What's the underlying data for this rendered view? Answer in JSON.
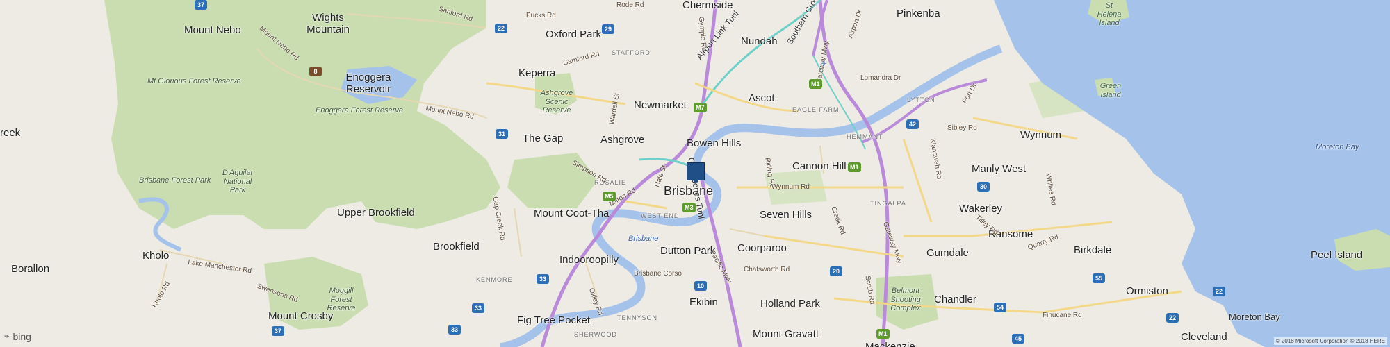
{
  "map": {
    "colors": {
      "land": "#eeebe4",
      "park": "#c9ddb0",
      "water": "#a4c2ea",
      "motorway": "#b98ad9",
      "major": "#f3d88a",
      "tunnel": "#6fd0c9"
    },
    "places": {
      "chermside": "Chermside",
      "pinkenba": "Pinkenba",
      "oxford_park": "Oxford Park",
      "nundah": "Nundah",
      "mount_nebo": "Mount Nebo",
      "wights_mountain": "Wights Mountain",
      "keperra": "Keperra",
      "enoggera_reservoir": "Enoggera Reservoir",
      "newmarket": "Newmarket",
      "ascot": "Ascot",
      "the_gap": "The Gap",
      "ashgrove": "Ashgrove",
      "bowen_hills": "Bowen Hills",
      "wynnum": "Wynnum",
      "cannon_hill": "Cannon Hill",
      "manly_west": "Manly West",
      "brisbane": "Brisbane",
      "mount_coot_tha": "Mount Coot-Tha",
      "seven_hills": "Seven Hills",
      "wakerley": "Wakerley",
      "upper_brookfield": "Upper Brookfield",
      "ransome": "Ransome",
      "brookfield": "Brookfield",
      "dutton_park": "Dutton Park",
      "coorparoo": "Coorparoo",
      "gumdale": "Gumdale",
      "kholo": "Kholo",
      "borallon": "Borallon",
      "indooroopilly": "Indooroopilly",
      "birkdale": "Birkdale",
      "peel_island": "Peel Island",
      "ormiston": "Ormiston",
      "chandler": "Chandler",
      "holland_park": "Holland Park",
      "mount_crosby": "Mount Crosby",
      "ekibin": "Ekibin",
      "fig_tree_pocket": "Fig Tree Pocket",
      "cleveland": "Cleveland",
      "mount_gravatt": "Mount Gravatt",
      "mackenzie": "Mackenzie",
      "creek": "reek"
    },
    "parks": {
      "mt_glorious": "Mt Glorious Forest Reserve",
      "enoggera_forest": "Enoggera Forest Reserve",
      "daguilar": "D'Aguilar National Park",
      "brisbane_forest": "Brisbane Forest Park",
      "ashgrove_scenic": "Ashgrove Scenic Reserve",
      "moggill": "Moggill Forest Reserve",
      "belmont": "Belmont Shooting Complex"
    },
    "water": {
      "moreton_bay_top": "Moreton Bay",
      "moreton_bay_bottom": "Moreton Bay",
      "brisbane_river": "Brisbane"
    },
    "islands": {
      "st_helena": "St Helena Island",
      "green": "Green Island"
    },
    "suburbs": {
      "stafford": "STAFFORD",
      "eagle_farm": "EAGLE FARM",
      "lytton": "LYTTON",
      "hemmant": "HEMMANT",
      "rosalie": "ROSALIE",
      "west_end": "WEST END",
      "tingalpa": "TINGALPA",
      "kenmore": "KENMORE",
      "tenninson": "TENNYSON",
      "sherwood": "SHERWOOD"
    },
    "roads": {
      "rode_rd": "Rode Rd",
      "sandford_rd": "Sanford Rd",
      "pineapple": "Pucks Rd",
      "samford_rd": "Samford Rd",
      "mount_nebo_rd": "Mount Nebo Rd",
      "mount_nebo_rd2": "Mount Nebo Rd",
      "wardell_st": "Wardell St",
      "simpson_rd": "Simpson Rd",
      "milton_rd": "Milton Rd",
      "hale_st": "Hale St",
      "gap_creek_rd": "Gap Creek Rd",
      "lake_manchester_rd": "Lake Manchester Rd",
      "kholo_rd": "Kholo Rd",
      "swensons_rd": "Swensons Rd",
      "brisbane_corso": "Brisbane Corso",
      "oxley_rd": "Oxley Rd",
      "pacific_mwy": "Pacific Mwy",
      "chatsworth_rd": "Chatsworth Rd",
      "riding_rd": "Riding Rd",
      "wynnum_rd": "Wynnum Rd",
      "creek_rd": "Creek Rd",
      "scrub_rd": "Scrub Rd",
      "gateway_mwy": "Gateway Mwy",
      "gateway_mwy2": "Gateway Mwy",
      "gympie_rd": "Gympie Rd",
      "airport_dr": "Airport Dr",
      "lomandra_dr": "Lomandra Dr",
      "port_dr": "Port Dr",
      "sibley_rd": "Sibley Rd",
      "kianawah_rd": "Kianawah Rd",
      "tilley_rd": "Tilley Rd",
      "quarry_rd": "Quarry Rd",
      "finucane_rd": "Finucane Rd",
      "whites_rd": "Whites Rd"
    },
    "tunnels": {
      "airport_link": "Airport Link Tunl",
      "clem_jones": "Clem Jones Tunl",
      "southern_cross": "Southern Cross Way"
    },
    "shields": {
      "s22a": "22",
      "s29": "29",
      "s8": "8",
      "s31": "31",
      "m7": "M7",
      "m5": "M5",
      "m3": "M3",
      "m1a": "M1",
      "m1b": "M1",
      "m1c": "M1",
      "s42": "42",
      "s30": "30",
      "s20": "20",
      "s10": "10",
      "s33a": "33",
      "s33b": "33",
      "s33c": "33",
      "s37": "37",
      "s55": "55",
      "s54": "54",
      "s45": "45",
      "s22b": "22",
      "s22c": "22",
      "s37top": "37"
    },
    "attribution": "© 2018 Microsoft Corporation © 2018 HERE",
    "logo": "bing"
  }
}
